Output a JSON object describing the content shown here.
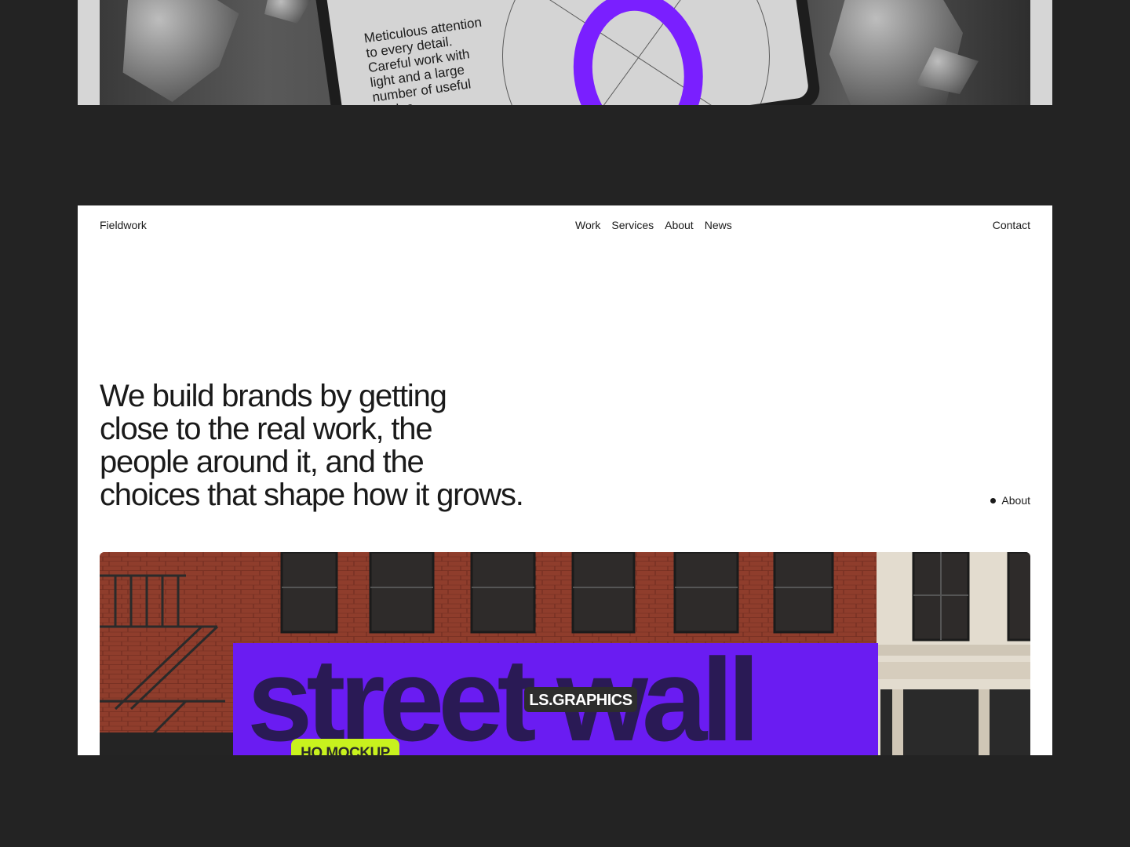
{
  "top_preview": {
    "tablet_text": "Meticulous attention to every detail. Careful work with light and a large number of useful angles.",
    "accent": "#7a1fff"
  },
  "header": {
    "logo": "Fieldwork",
    "nav": [
      "Work",
      "Services",
      "About",
      "News"
    ],
    "contact": "Contact"
  },
  "hero": {
    "headline_lines": [
      "We build brands by getting",
      "close to the real work, the",
      "people around it, and the",
      "choices that shape how it grows."
    ],
    "about_link": "About"
  },
  "image": {
    "billboard_text": "street wall",
    "badge_brand": "LS.GRAPHICS",
    "badge_tag": "HQ MOCKUP",
    "billboard_color": "#6a1cf2",
    "tag_color": "#c8f21e",
    "brick_color": "#8f3d2c"
  },
  "colors": {
    "page_bg": "#232323",
    "card_bg": "#ffffff",
    "text": "#1a1a1a"
  }
}
